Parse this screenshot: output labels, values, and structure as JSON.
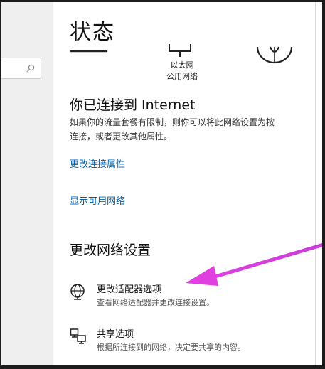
{
  "page": {
    "title": "状态"
  },
  "network_status": {
    "ethernet_name": "以太网",
    "ethernet_type": "公用网络"
  },
  "connection": {
    "heading": "你已连接到 Internet",
    "description_line1": "如果你的流量套餐有限制，则你可以将此网络设置为按",
    "description_line2": "连接，或者更改其他属性。",
    "link_properties": "更改连接属性",
    "link_show_networks": "显示可用网络"
  },
  "change_settings": {
    "heading": "更改网络设置",
    "options": [
      {
        "title": "更改适配器选项",
        "description": "查看网络适配器并更改连接设置。",
        "icon": "adapter-globe-icon"
      },
      {
        "title": "共享选项",
        "description": "根据所连接到的网络，决定要共享的内容。",
        "icon": "sharing-icon"
      }
    ]
  },
  "annotation": {
    "arrow_color": "#e040e0"
  },
  "colors": {
    "link": "#0063b1",
    "nav_background": "#efefef",
    "frame": "#1c1c1c"
  }
}
